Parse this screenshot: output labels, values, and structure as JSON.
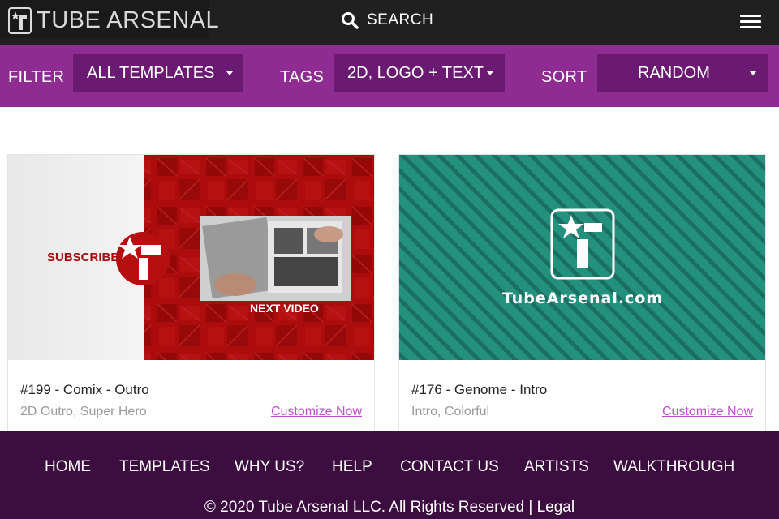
{
  "header": {
    "logo_text": "TUBE ARSENAL",
    "search_label": "SEARCH"
  },
  "filters": {
    "filter_label": "FILTER",
    "filter_value": "ALL TEMPLATES",
    "tags_label": "TAGS",
    "tags_value": "2D, LOGO + TEXT",
    "sort_label": "SORT",
    "sort_value": "RANDOM"
  },
  "cards": [
    {
      "title": "#199 - Comix - Outro",
      "tags": "2D Outro, Super Hero",
      "link": "Customize Now",
      "thumb_subscribe": "SUBSCRIBE",
      "thumb_next": "NEXT VIDEO"
    },
    {
      "title": "#176 - Genome - Intro",
      "tags": "Intro, Colorful",
      "link": "Customize Now",
      "thumb_site": "TubeArsenal.com"
    }
  ],
  "footer": {
    "nav": [
      "HOME",
      "TEMPLATES",
      "WHY US?",
      "HELP",
      "CONTACT US",
      "ARTISTS",
      "WALKTHROUGH"
    ],
    "copyright": "© 2020 Tube Arsenal LLC. All Rights Reserved |",
    "legal": "Legal"
  },
  "colors": {
    "header_bg": "#1f201f",
    "filterbar_bg": "#8e2c92",
    "dropdown_bg": "#6b1a71",
    "footer_bg": "#3c0e3f",
    "link": "#c24bd3",
    "comix_red": "#b40f0f",
    "genome_teal": "#23907e"
  },
  "icons": [
    "logo-icon",
    "search-icon",
    "menu-icon",
    "caret-down-icon"
  ]
}
